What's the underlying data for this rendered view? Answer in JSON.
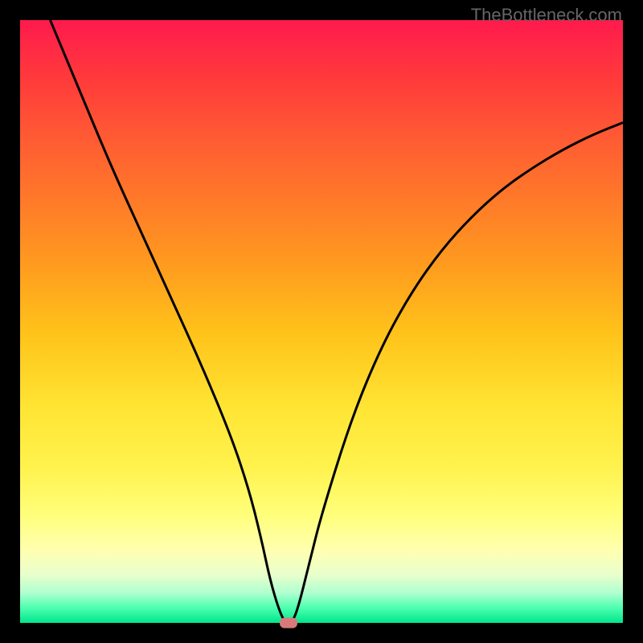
{
  "attribution": "TheBottleneck.com",
  "chart_data": {
    "type": "line",
    "title": "",
    "xlabel": "",
    "ylabel": "",
    "xlim": [
      0,
      100
    ],
    "ylim": [
      0,
      100
    ],
    "grid": false,
    "legend": false,
    "background_gradient": [
      "#ff1a4d",
      "#ff991f",
      "#ffe433",
      "#00e68c"
    ],
    "series": [
      {
        "name": "bottleneck-curve",
        "color": "#000000",
        "x": [
          5,
          10,
          15,
          20,
          25,
          30,
          35,
          38,
          40,
          41.5,
          43,
          44,
          45,
          46,
          48,
          50,
          55,
          60,
          65,
          70,
          75,
          80,
          85,
          90,
          95,
          100
        ],
        "values": [
          100,
          88,
          76,
          65,
          54,
          43,
          31,
          22,
          14,
          7,
          2,
          0,
          0,
          2,
          10,
          18,
          34,
          46,
          55,
          62,
          67.5,
          72,
          75.5,
          78.5,
          81,
          83
        ]
      }
    ],
    "marker": {
      "x": 44.5,
      "y": 0,
      "color": "#d97a7a"
    }
  }
}
